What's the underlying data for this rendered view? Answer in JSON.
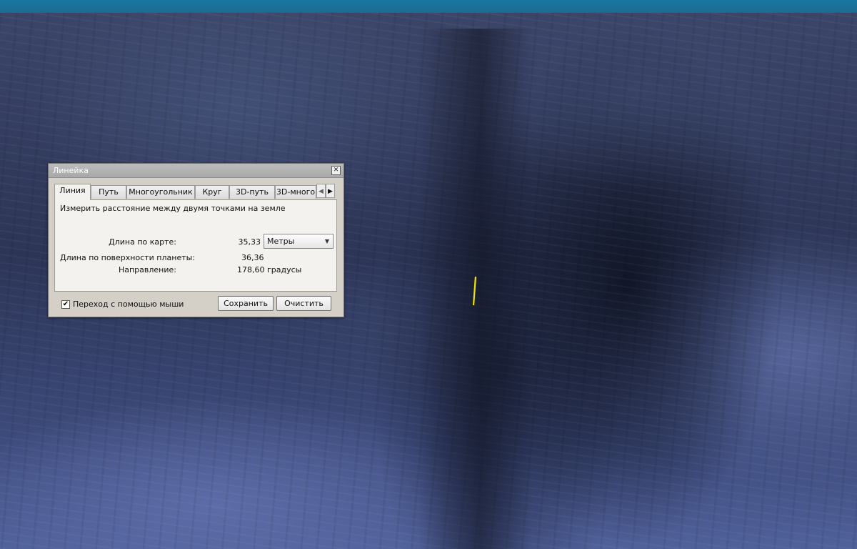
{
  "viewport": {
    "colors": {
      "sea": "#1a78a0",
      "seafloor": "#2a3350",
      "measure_line": "#f2e600"
    }
  },
  "ruler": {
    "title": "Линейка",
    "close_icon": "close-icon",
    "tabs": [
      {
        "label": "Линия",
        "active": true
      },
      {
        "label": "Путь",
        "active": false
      },
      {
        "label": "Многоугольник",
        "active": false
      },
      {
        "label": "Круг",
        "active": false
      },
      {
        "label": "3D-путь",
        "active": false
      },
      {
        "label": "3D-много",
        "active": false
      }
    ],
    "tab_scroll": {
      "left_icon": "chevron-left-icon",
      "right_icon": "chevron-right-icon"
    },
    "description": "Измерить расстояние между двумя точками на земле",
    "map_length": {
      "label": "Длина по карте:",
      "value": "35,33"
    },
    "unit": {
      "selected": "Метры",
      "icon": "chevron-down-icon"
    },
    "surface_length": {
      "label": "Длина по поверхности планеты:",
      "value": "36,36"
    },
    "heading": {
      "label": "Направление:",
      "value": "178,60 градусы"
    },
    "mouse_navigation": {
      "label": "Переход с помощью мыши",
      "checked": true
    },
    "save_label": "Сохранить",
    "clear_label": "Очистить"
  }
}
